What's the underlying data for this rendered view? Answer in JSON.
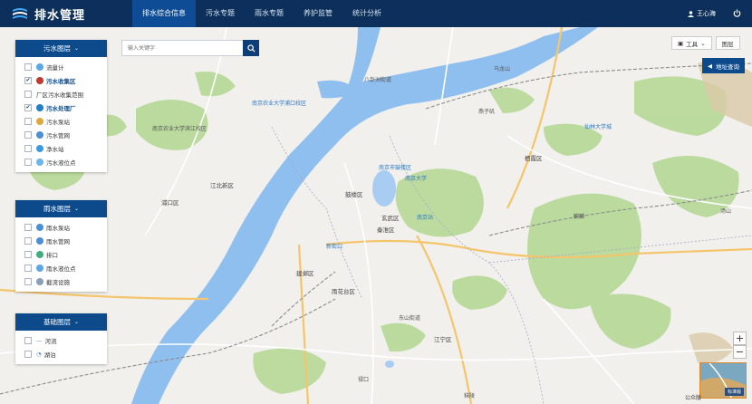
{
  "app": {
    "title": "排水管理"
  },
  "nav": {
    "items": [
      {
        "label": "排水综合信息",
        "active": true
      },
      {
        "label": "污水专题",
        "active": false
      },
      {
        "label": "雨水专题",
        "active": false
      },
      {
        "label": "养护监管",
        "active": false
      },
      {
        "label": "统计分析",
        "active": false
      }
    ]
  },
  "user": {
    "name": "王心海"
  },
  "search": {
    "placeholder": "输入关键字"
  },
  "panels": {
    "sewage": {
      "title": "污水图层",
      "layers": [
        {
          "label": "流量计",
          "checked": false,
          "icon_color": "#5aa9e6",
          "bold": false
        },
        {
          "label": "污水收集区",
          "checked": true,
          "icon_color": "#c0392b",
          "bold": true
        },
        {
          "label": "厂区污水收集范围",
          "checked": false,
          "icon_color": "",
          "bold": false
        },
        {
          "label": "污水处理厂",
          "checked": true,
          "icon_color": "#1f7fc8",
          "bold": true
        },
        {
          "label": "污水泵站",
          "checked": false,
          "icon_color": "#e0a93b",
          "bold": false
        },
        {
          "label": "污水管网",
          "checked": false,
          "icon_color": "#4e8ed6",
          "bold": false
        },
        {
          "label": "净水站",
          "checked": false,
          "icon_color": "#3c9ae0",
          "bold": false
        },
        {
          "label": "污水液位点",
          "checked": false,
          "icon_color": "#6cb6ea",
          "bold": false
        }
      ]
    },
    "rain": {
      "title": "雨水图层",
      "layers": [
        {
          "label": "雨水泵站",
          "checked": false,
          "icon_color": "#4a90d9"
        },
        {
          "label": "雨水管网",
          "checked": false,
          "icon_color": "#4e8ed6"
        },
        {
          "label": "排口",
          "checked": false,
          "icon_color": "#3fae7a"
        },
        {
          "label": "雨水液位点",
          "checked": false,
          "icon_color": "#5aa9e6"
        },
        {
          "label": "截流设施",
          "checked": false,
          "icon_color": "#8aa0b8"
        }
      ]
    },
    "base": {
      "title": "基础图层",
      "layers": [
        {
          "label": "河流",
          "checked": false,
          "icon": "—"
        },
        {
          "label": "湖泊",
          "checked": false,
          "icon": "◔"
        }
      ]
    }
  },
  "tools": {
    "tool_label": "工具",
    "layer_label": "图层",
    "address_label": "地址查询"
  },
  "map": {
    "labels": [
      "南京农业大学滨江校区",
      "南京农业大学浦口校区",
      "八卦洲街道",
      "燕子矶",
      "乌龙山",
      "仙林大学城",
      "栖霞区",
      "南京市鼓楼区",
      "南京大学",
      "鼓楼区",
      "玄武区",
      "秦淮区",
      "雨花台区",
      "建邺区",
      "江宁区",
      "浦口区",
      "江北新区",
      "汤山",
      "麒麟",
      "东山街道",
      "南京站",
      "新街口",
      "秣陵",
      "禄口"
    ],
    "credit": "公众版",
    "minimap_tag": "标准版"
  }
}
